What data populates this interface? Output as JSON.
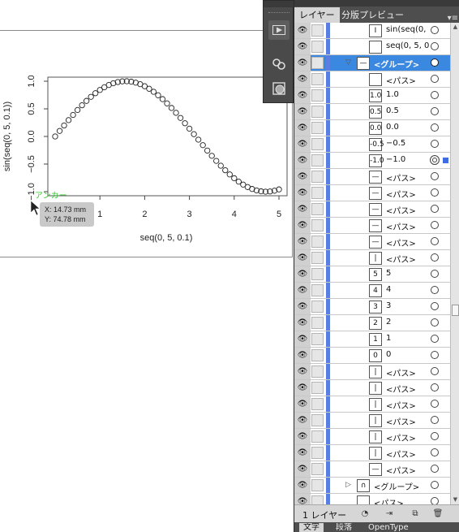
{
  "canvas": {
    "chart_data": {
      "type": "scatter",
      "x": [
        0,
        0.1,
        0.2,
        0.3,
        0.4,
        0.5,
        0.6,
        0.7,
        0.8,
        0.9,
        1.0,
        1.1,
        1.2,
        1.3,
        1.4,
        1.5,
        1.6,
        1.7,
        1.8,
        1.9,
        2.0,
        2.1,
        2.2,
        2.3,
        2.4,
        2.5,
        2.6,
        2.7,
        2.8,
        2.9,
        3.0,
        3.1,
        3.2,
        3.3,
        3.4,
        3.5,
        3.6,
        3.7,
        3.8,
        3.9,
        4.0,
        4.1,
        4.2,
        4.3,
        4.4,
        4.5,
        4.6,
        4.7,
        4.8,
        4.9,
        5.0
      ],
      "y": [
        0.0,
        0.0998,
        0.1987,
        0.2955,
        0.3894,
        0.4794,
        0.5646,
        0.6442,
        0.7174,
        0.7833,
        0.8415,
        0.8912,
        0.932,
        0.9636,
        0.9854,
        0.9975,
        0.9996,
        0.9917,
        0.9738,
        0.9463,
        0.9093,
        0.8632,
        0.8085,
        0.7457,
        0.6755,
        0.5985,
        0.5155,
        0.4274,
        0.335,
        0.2392,
        0.1411,
        0.0416,
        -0.0584,
        -0.1577,
        -0.2555,
        -0.3508,
        -0.4425,
        -0.5298,
        -0.6119,
        -0.6878,
        -0.7568,
        -0.8183,
        -0.8716,
        -0.9162,
        -0.9516,
        -0.9775,
        -0.9937,
        -0.9999,
        -0.9962,
        -0.9825,
        -0.9589
      ],
      "xlabel": "seq(0, 5, 0.1)",
      "ylabel": "sin(seq(0, 5, 0.1))",
      "xticks": [
        "1",
        "2",
        "3",
        "4",
        "5"
      ],
      "xtick_values": [
        1,
        2,
        3,
        4,
        5
      ],
      "yticks": [
        "−1.0",
        "−0.5",
        "0.0",
        "0.5",
        "1.0"
      ],
      "ytick_values": [
        -1.0,
        -0.5,
        0.0,
        0.5,
        1.0
      ],
      "xlim": [
        0,
        5
      ],
      "ylim": [
        -1.0,
        1.0
      ],
      "marker": "open-circle",
      "grid": false
    },
    "anchor_label": "アンカー",
    "tooltip": {
      "x": "X: 14.73 mm",
      "y": "Y: 74.78 mm"
    }
  },
  "toolstrip": {
    "icons": [
      "play-icon",
      "link-icon",
      "appearance-icon"
    ]
  },
  "panel": {
    "tabs": [
      "レイヤー",
      "分版プレビュー"
    ],
    "menu_icon": "panel-menu-icon",
    "footer": {
      "layer_count": "1 レイヤー"
    },
    "bottom_tabs": [
      "文字",
      "段落",
      "OpenType"
    ],
    "accent_color": "#3a88e0",
    "layer_color": "#5b7fe0",
    "rows": [
      {
        "name": "sin(seq(0, ...",
        "thumb": "I",
        "indent": 1
      },
      {
        "name": "seq(0, 5, 0....",
        "thumb": "",
        "indent": 1
      },
      {
        "name": "<グループ>",
        "thumb": "—",
        "indent": 0,
        "selected": true,
        "expanded": true
      },
      {
        "name": "<パス>",
        "thumb": "",
        "indent": 1
      },
      {
        "name": "1.0",
        "thumb": "1.0",
        "indent": 1
      },
      {
        "name": "0.5",
        "thumb": "0.5",
        "indent": 1
      },
      {
        "name": "0.0",
        "thumb": "0.0",
        "indent": 1
      },
      {
        "name": "−0.5",
        "thumb": "-0.5",
        "indent": 1
      },
      {
        "name": "−1.0",
        "thumb": "-1.0",
        "indent": 1,
        "targeted": true
      },
      {
        "name": "<パス>",
        "thumb": "—",
        "indent": 1
      },
      {
        "name": "<パス>",
        "thumb": "—",
        "indent": 1
      },
      {
        "name": "<パス>",
        "thumb": "—",
        "indent": 1
      },
      {
        "name": "<パス>",
        "thumb": "—",
        "indent": 1
      },
      {
        "name": "<パス>",
        "thumb": "—",
        "indent": 1
      },
      {
        "name": "<パス>",
        "thumb": "|",
        "indent": 1
      },
      {
        "name": "5",
        "thumb": "5",
        "indent": 1
      },
      {
        "name": "4",
        "thumb": "4",
        "indent": 1
      },
      {
        "name": "3",
        "thumb": "3",
        "indent": 1
      },
      {
        "name": "2",
        "thumb": "2",
        "indent": 1
      },
      {
        "name": "1",
        "thumb": "1",
        "indent": 1
      },
      {
        "name": "0",
        "thumb": "0",
        "indent": 1
      },
      {
        "name": "<パス>",
        "thumb": "|",
        "indent": 1
      },
      {
        "name": "<パス>",
        "thumb": "|",
        "indent": 1
      },
      {
        "name": "<パス>",
        "thumb": "|",
        "indent": 1
      },
      {
        "name": "<パス>",
        "thumb": "|",
        "indent": 1
      },
      {
        "name": "<パス>",
        "thumb": "|",
        "indent": 1
      },
      {
        "name": "<パス>",
        "thumb": "|",
        "indent": 1
      },
      {
        "name": "<パス>",
        "thumb": "—",
        "indent": 1
      },
      {
        "name": "<グループ>",
        "thumb": "∩",
        "indent": 0,
        "collapsed": true
      },
      {
        "name": "<パス>",
        "thumb": "",
        "indent": 0
      }
    ]
  }
}
